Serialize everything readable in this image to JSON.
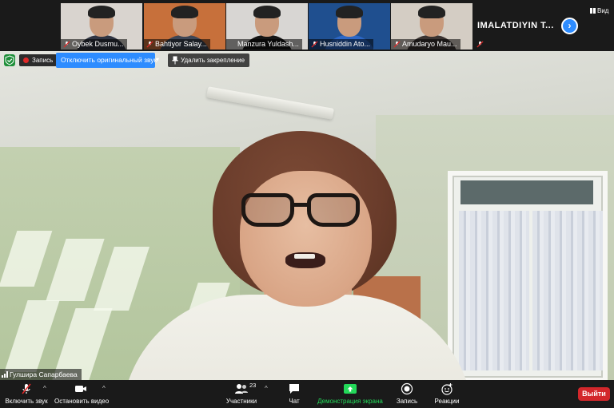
{
  "thumbnails": [
    {
      "name": "Oybek Dusmu...",
      "bg": "#d9d4cf",
      "shirt": "#2f3442"
    },
    {
      "name": "Bahtiyor Salay...",
      "bg": "#c7703b",
      "shirt": "#3d4555"
    },
    {
      "name": "Manzura Yuldash...",
      "bg": "#d8d6d3",
      "shirt": "#151515"
    },
    {
      "name": "Husniddin Ato...",
      "bg": "#1f4f8f",
      "shirt": "#2c67c6"
    },
    {
      "name": "Amudaryo Mau...",
      "bg": "#d4cdc4",
      "shirt": "#3a3331"
    }
  ],
  "name_tile": "IMALATDIYIN T...",
  "view_label": "Вид",
  "overlay": {
    "record_label": "Запись",
    "original_audio_label": "Отключить оригинальный звук",
    "unpin_label": "Удалить закрепление"
  },
  "speaker_name": "Гулшира Сапарбаева",
  "toolbar": {
    "audio_label": "Включить звук",
    "video_label": "Остановить видео",
    "participants_label": "Участники",
    "participants_count": "23",
    "chat_label": "Чат",
    "share_label": "Демонстрация экрана",
    "record_label": "Запись",
    "reactions_label": "Реакции",
    "exit_label": "Выйти"
  },
  "colors": {
    "accent_blue": "#2d8cff",
    "share_green": "#23d959",
    "exit_red": "#d3272b",
    "muted_red": "#e02828"
  }
}
